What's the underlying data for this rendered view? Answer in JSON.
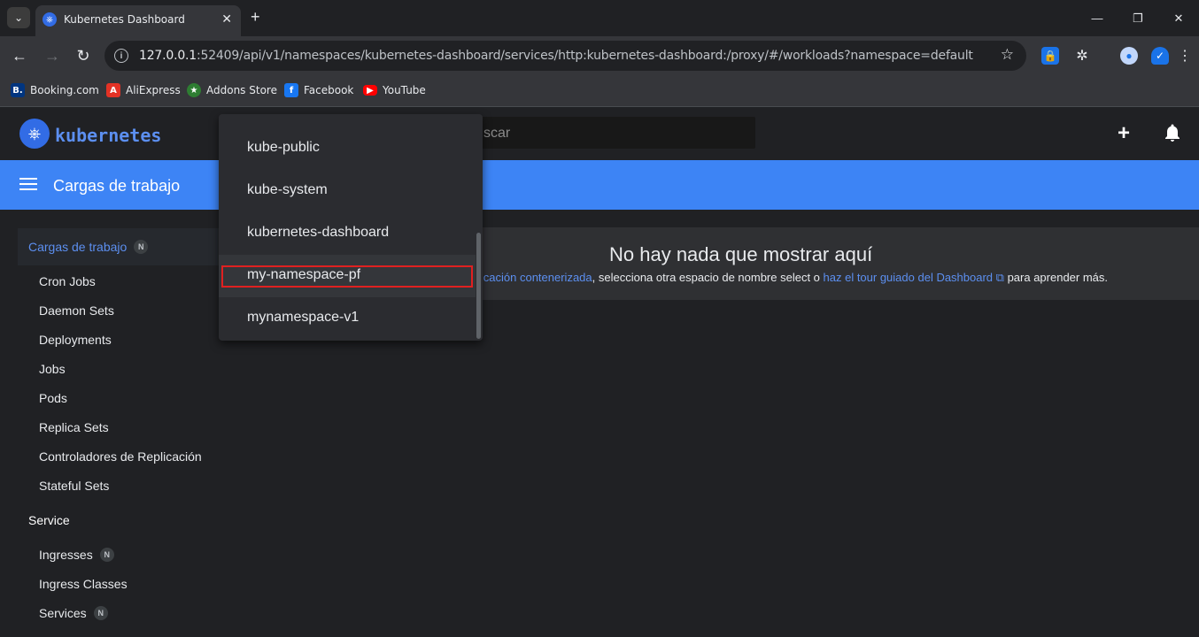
{
  "browser": {
    "tab_title": "Kubernetes Dashboard",
    "url_host": "127.0.0.1",
    "url_rest": ":52409/api/v1/namespaces/kubernetes-dashboard/services/http:kubernetes-dashboard:/proxy/#/workloads?namespace=default",
    "bookmarks": [
      {
        "label": "Booking.com",
        "icon": "booking-icon",
        "color": "#003580"
      },
      {
        "label": "AliExpress",
        "icon": "aliexpress-icon",
        "color": "#e43225"
      },
      {
        "label": "Addons Store",
        "icon": "addons-icon",
        "color": "#2e7d32"
      },
      {
        "label": "Facebook",
        "icon": "facebook-icon",
        "color": "#1877f2"
      },
      {
        "label": "YouTube",
        "icon": "youtube-icon",
        "color": "#ff0000"
      }
    ]
  },
  "app": {
    "brand": "kubernetes",
    "search_placeholder": "scar",
    "section_title": "Cargas de trabajo",
    "accent": "#3d84f5"
  },
  "sidebar": {
    "workloads_label": "Cargas de trabajo",
    "workloads_badge": "N",
    "workload_items": [
      "Cron Jobs",
      "Daemon Sets",
      "Deployments",
      "Jobs",
      "Pods",
      "Replica Sets",
      "Controladores de Replicación",
      "Stateful Sets"
    ],
    "service_label": "Service",
    "service_items": [
      {
        "label": "Ingresses",
        "badge": "N"
      },
      {
        "label": "Ingress Classes",
        "badge": ""
      },
      {
        "label": "Services",
        "badge": "N"
      }
    ]
  },
  "main": {
    "empty_title": "No hay nada que mostrar aquí",
    "empty_link1": "licación contenerizada",
    "empty_mid": ", selecciona otra espacio de nombre select o ",
    "empty_link2": "haz el tour guiado del Dashboard",
    "empty_end": " para aprender más."
  },
  "namespace_dropdown": {
    "options": [
      "kube-public",
      "kube-system",
      "kubernetes-dashboard",
      "my-namespace-pf",
      "mynamespace-v1"
    ],
    "highlighted": "my-namespace-pf"
  }
}
